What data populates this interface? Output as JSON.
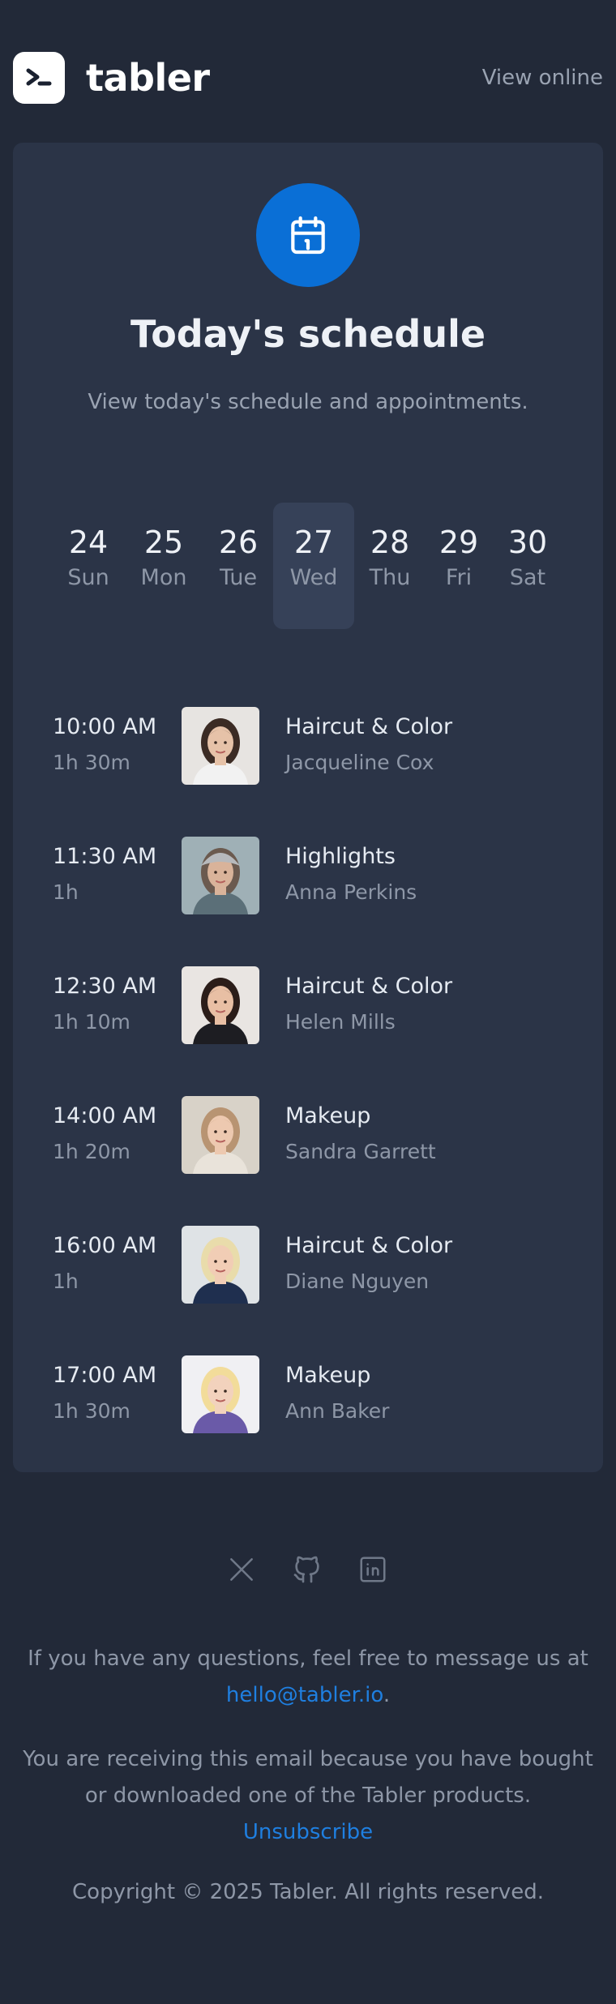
{
  "header": {
    "brand": "tabler",
    "view_online": "View online"
  },
  "main": {
    "icon": "calendar-icon",
    "title": "Today's schedule",
    "subtitle": "View today's schedule and appointments.",
    "days": [
      {
        "num": "24",
        "name": "Sun",
        "active": false
      },
      {
        "num": "25",
        "name": "Mon",
        "active": false
      },
      {
        "num": "26",
        "name": "Tue",
        "active": false
      },
      {
        "num": "27",
        "name": "Wed",
        "active": true
      },
      {
        "num": "28",
        "name": "Thu",
        "active": false
      },
      {
        "num": "29",
        "name": "Fri",
        "active": false
      },
      {
        "num": "30",
        "name": "Sat",
        "active": false
      }
    ],
    "appointments": [
      {
        "time": "10:00 AM",
        "duration": "1h 30m",
        "service": "Haircut & Color",
        "client": "Jacqueline Cox"
      },
      {
        "time": "11:30 AM",
        "duration": "1h",
        "service": "Highlights",
        "client": "Anna Perkins"
      },
      {
        "time": "12:30 AM",
        "duration": "1h 10m",
        "service": "Haircut & Color",
        "client": "Helen Mills"
      },
      {
        "time": "14:00 AM",
        "duration": "1h 20m",
        "service": "Makeup",
        "client": "Sandra Garrett"
      },
      {
        "time": "16:00 AM",
        "duration": "1h",
        "service": "Haircut & Color",
        "client": "Diane Nguyen"
      },
      {
        "time": "17:00 AM",
        "duration": "1h 30m",
        "service": "Makeup",
        "client": "Ann Baker"
      }
    ]
  },
  "footer": {
    "social_icons": [
      "x-icon",
      "github-icon",
      "linkedin-icon"
    ],
    "questions_text": "If you have any questions, feel free to message us at",
    "email": "hello@tabler.io",
    "email_suffix": ".",
    "receiving_text": "You are receiving this email because you have bought or downloaded one of the Tabler products.",
    "unsubscribe": "Unsubscribe",
    "copyright": "Copyright © 2025 Tabler. All rights reserved."
  },
  "colors": {
    "background": "#222938",
    "card": "#2b3447",
    "accent": "#0a6fd6",
    "link": "#1f7fe0",
    "muted_text": "#8e97a7"
  }
}
